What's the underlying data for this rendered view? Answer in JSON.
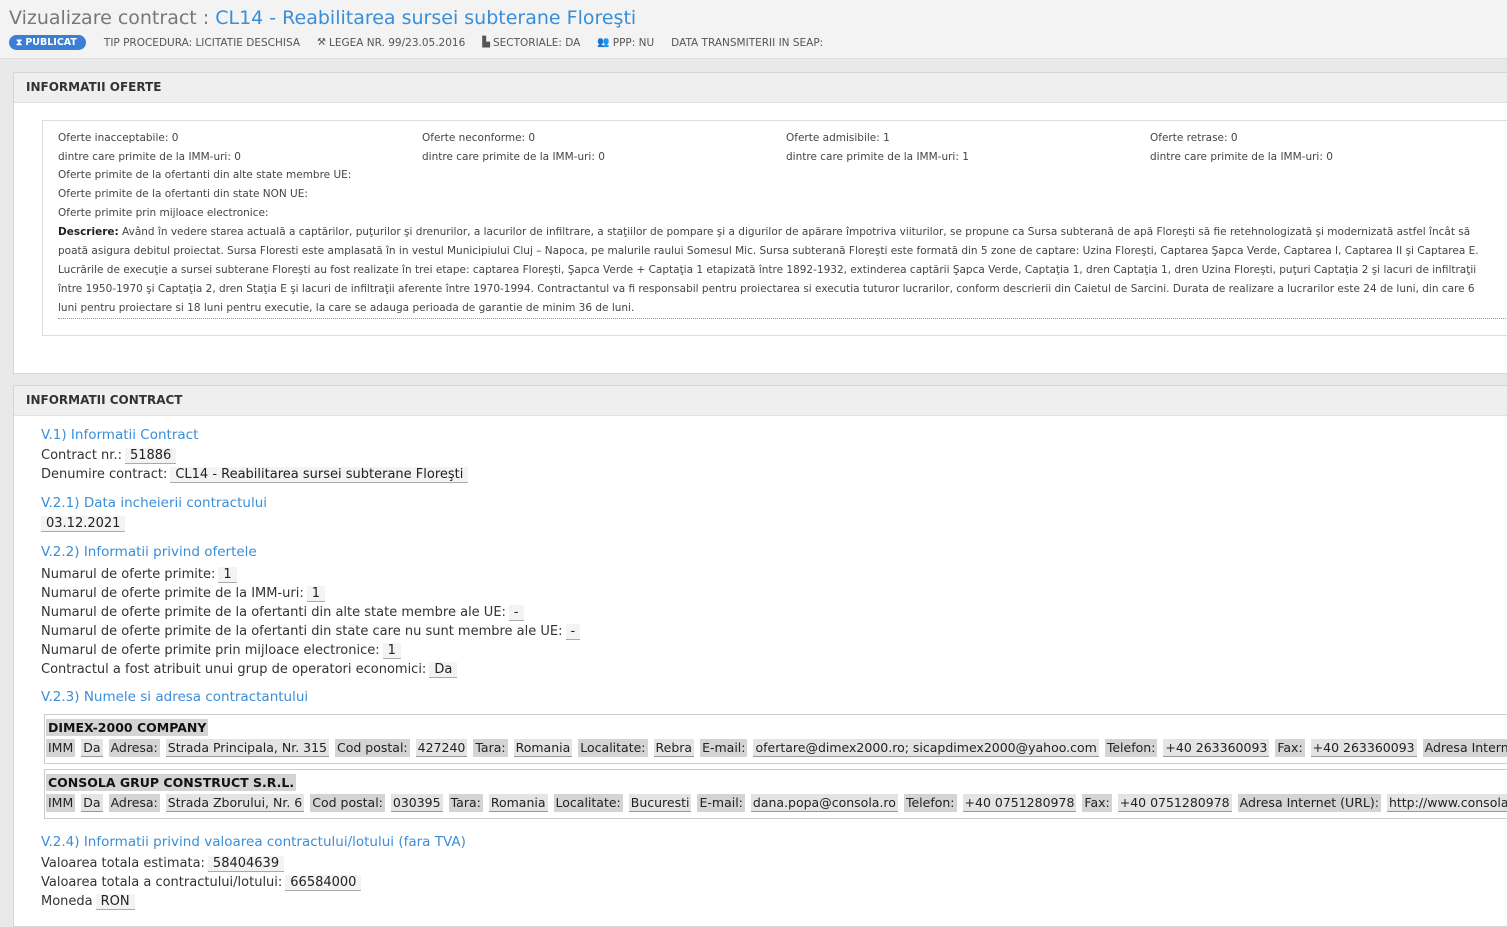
{
  "header": {
    "title_prefix": "Vizualizare contract : ",
    "contract_name": "CL14 - Reabilitarea sursei subterane Floreşti",
    "badge": "PUBLICAT",
    "tip_procedura": "TIP PROCEDURA: LICITATIE DESCHISA",
    "legea": "LEGEA NR. 99/23.05.2016",
    "sectoriale": "SECTORIALE: DA",
    "ppp": "PPP: NU",
    "data_transmiterii": "DATA TRANSMITERII IN SEAP:"
  },
  "oferte": {
    "heading": "INFORMATII OFERTE",
    "grid": [
      [
        "Oferte inacceptabile: 0",
        "Oferte neconforme: 0",
        "Oferte admisibile: 1",
        "Oferte retrase: 0"
      ],
      [
        "dintre care primite de la IMM-uri: 0",
        "dintre care primite de la IMM-uri: 0",
        "dintre care primite de la IMM-uri: 1",
        "dintre care primite de la IMM-uri: 0"
      ]
    ],
    "line_ue": "Oferte primite de la ofertanti din alte state membre UE:",
    "line_non_ue": "Oferte primite de la ofertanti din state NON UE:",
    "line_electronic": "Oferte primite prin mijloace electronice:",
    "descriere_label": "Descriere:",
    "descriere_text": " Având în vedere starea actuală a captărilor, puţurilor şi drenurilor, a lacurilor de infiltrare, a staţiilor de pompare şi a digurilor de apărare împotriva viiturilor, se propune ca Sursa subterană de apă Floreşti să fie retehnologizată şi modernizată astfel încât să poată asigura debitul proiectat. Sursa Floresti este amplasată în in vestul Municipiului Cluj – Napoca, pe malurile raului Somesul Mic. Sursa subterană Floreşti este formată din 5 zone de captare: Uzina Floreşti, Captarea Şapca Verde, Captarea I, Captarea II şi Captarea E. Lucrările de execuţie a sursei subterane Floreşti au fost realizate în trei etape: captarea Floreşti, Şapca Verde + Captaţia 1 etapizată între 1892-1932, extinderea captării Şapca Verde, Captaţia 1, dren Captaţia 1, dren Uzina Floreşti, puţuri Captaţia 2 şi lacuri de infiltraţii între 1950-1970 şi Captaţia 2, dren Staţia E şi lacuri de infiltraţii aferente între 1970-1994. Contractantul va fi responsabil pentru proiectarea si executia tuturor lucrarilor, conform descrierii din Caietul de Sarcini. Durata de realizare a lucrarilor este 24 de luni, din care 6 luni pentru proiectare si 18 luni pentru executie, la care se adauga perioada de garantie de minim 36 de luni."
  },
  "contract": {
    "heading": "INFORMATII CONTRACT",
    "s1": "V.1) Informatii Contract",
    "contract_nr_label": "Contract nr.:",
    "contract_nr": "51886",
    "denumire_label": "Denumire contract:",
    "denumire": "CL14 - Reabilitarea sursei subterane Floreşti",
    "s21": "V.2.1) Data incheierii contractului",
    "data": "03.12.2021",
    "s22": "V.2.2) Informatii privind ofertele",
    "nr_oferte_label": "Numarul de oferte primite:",
    "nr_oferte": "1",
    "nr_imm_label": "Numarul de oferte primite de la IMM-uri:",
    "nr_imm": "1",
    "nr_ue_label": "Numarul de oferte primite de la ofertanti din alte state membre ale UE:",
    "nr_ue": "-",
    "nr_non_ue_label": "Numarul de oferte primite de la ofertanti din state care nu sunt membre ale UE:",
    "nr_non_ue": "-",
    "nr_electronic_label": "Numarul de oferte primite prin mijloace electronice:",
    "nr_electronic": "1",
    "grup_label": "Contractul a fost atribuit unui grup de operatori economici:",
    "grup": "Da",
    "s23": "V.2.3) Numele si adresa contractantului",
    "contractors": [
      {
        "name": "DIMEX-2000 COMPANY",
        "fields": [
          "IMM",
          "Da",
          "Adresa:",
          "Strada Principala, Nr. 315",
          "Cod postal:",
          "427240",
          "Tara:",
          "Romania",
          "Localitate:",
          "Rebra",
          "E-mail:",
          "ofertare@dimex2000.ro; sicapdimex2000@yahoo.com",
          "Telefon:",
          "+40 263360093",
          "Fax:",
          "+40 263360093",
          "Adresa Internet (URL):"
        ]
      },
      {
        "name": "CONSOLA GRUP CONSTRUCT S.R.L.",
        "fields": [
          "IMM",
          "Da",
          "Adresa:",
          "Strada Zborului, Nr. 6",
          "Cod postal:",
          "030395",
          "Tara:",
          "Romania",
          "Localitate:",
          "Bucuresti",
          "E-mail:",
          "dana.popa@consola.ro",
          "Telefon:",
          "+40 0751280978",
          "Fax:",
          "+40 0751280978",
          "Adresa Internet (URL):",
          "http://www.consola.ro/"
        ]
      }
    ],
    "s24": "V.2.4) Informatii privind valoarea contractului/lotului (fara TVA)",
    "val_estimata_label": "Valoarea totala estimata:",
    "val_estimata": "58404639",
    "val_totala_label": "Valoarea totala a contractului/lotului:",
    "val_totala": "66584000",
    "moneda_label": "Moneda",
    "moneda": "RON"
  }
}
